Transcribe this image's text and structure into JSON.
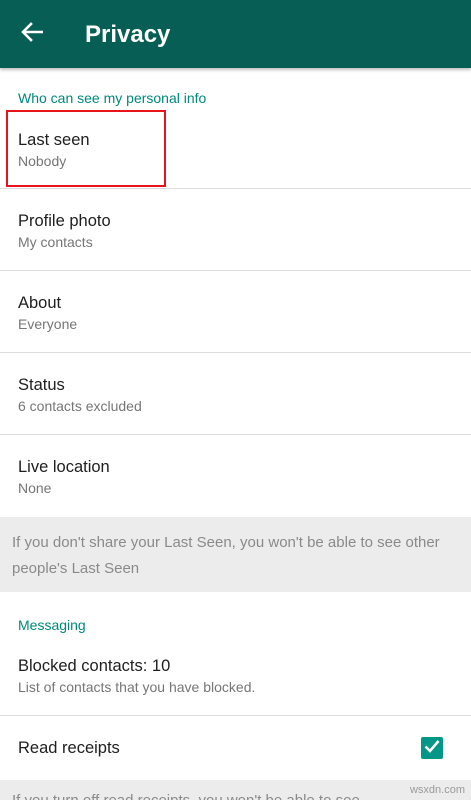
{
  "appbar": {
    "title": "Privacy",
    "back_icon": "arrow-left-icon"
  },
  "sections": {
    "personal_info": "Who can see my personal info",
    "messaging": "Messaging"
  },
  "personal_info_items": [
    {
      "label": "Last seen",
      "value": "Nobody"
    },
    {
      "label": "Profile photo",
      "value": "My contacts"
    },
    {
      "label": "About",
      "value": "Everyone"
    },
    {
      "label": "Status",
      "value": "6 contacts excluded"
    },
    {
      "label": "Live location",
      "value": "None"
    }
  ],
  "last_seen_note": "If you don't share your Last Seen, you won't be able to see other people's Last Seen",
  "blocked": {
    "label": "Blocked contacts: 10",
    "description": "List of contacts that you have blocked."
  },
  "read_receipts": {
    "label": "Read receipts",
    "checked": true
  },
  "watermark": "wsxdn.com",
  "colors": {
    "appbar": "#075e54",
    "accent": "#00897b",
    "checkbox": "#009688",
    "highlight": "#e8141c"
  }
}
